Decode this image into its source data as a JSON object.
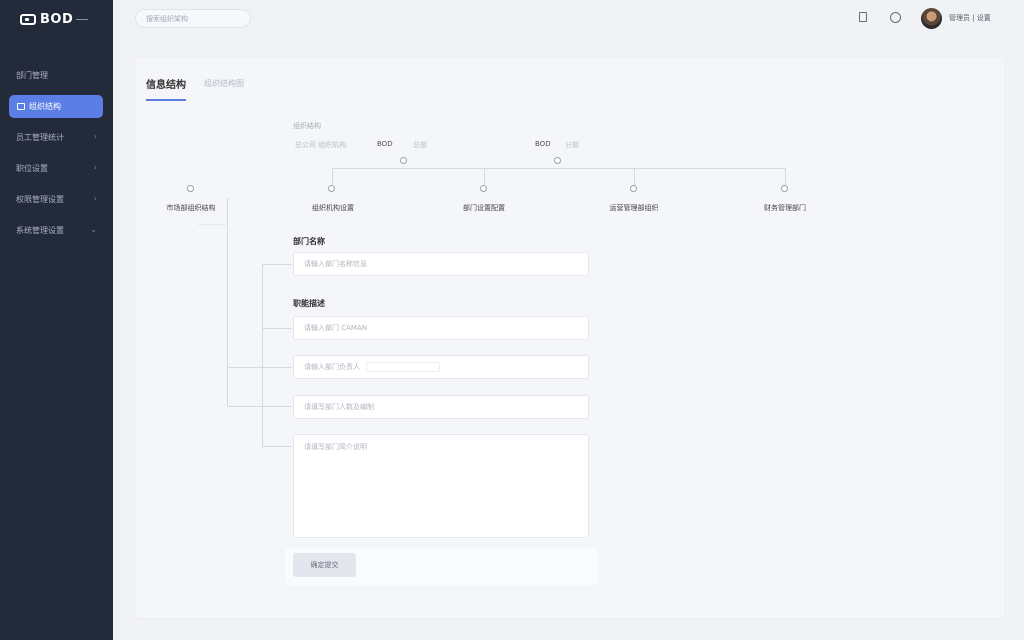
{
  "brand": {
    "text": "BOD"
  },
  "sidebar": {
    "items": [
      {
        "label": "部门管理",
        "active": false
      },
      {
        "label": "组织结构",
        "active": true
      },
      {
        "label": "员工管理统计",
        "active": false
      },
      {
        "label": "职位设置",
        "active": false
      },
      {
        "label": "权限管理设置",
        "active": false
      },
      {
        "label": "系统管理设置",
        "active": false
      }
    ]
  },
  "topbar": {
    "search_placeholder": "搜索组织架构",
    "username": "管理员 | 设置"
  },
  "tabs": [
    {
      "label": "信息结构",
      "active": true
    },
    {
      "label": "组织结构图",
      "active": false
    }
  ],
  "tree": {
    "header_label": "组织结构",
    "top_left": "总公司 组织机构",
    "mid_a": "BOD",
    "mid_a_sub": "总部",
    "mid_b": "BOD",
    "mid_b_sub": "分部",
    "left_root": "市场部组织结构",
    "branches": [
      "组织机构设置",
      "部门设置配置",
      "运营管理部组织",
      "财务管理部门"
    ]
  },
  "form": {
    "name_label": "部门名称",
    "name_placeholder": "请输入部门名称信息",
    "desc_label": "职能描述",
    "field1_placeholder": "请输入部门 CAMAN",
    "field2_placeholder": "请输入部门负责人",
    "field3_placeholder": "请填写部门人数及编制",
    "textarea_placeholder": "请填写部门简介说明",
    "submit_label": "确定提交"
  }
}
